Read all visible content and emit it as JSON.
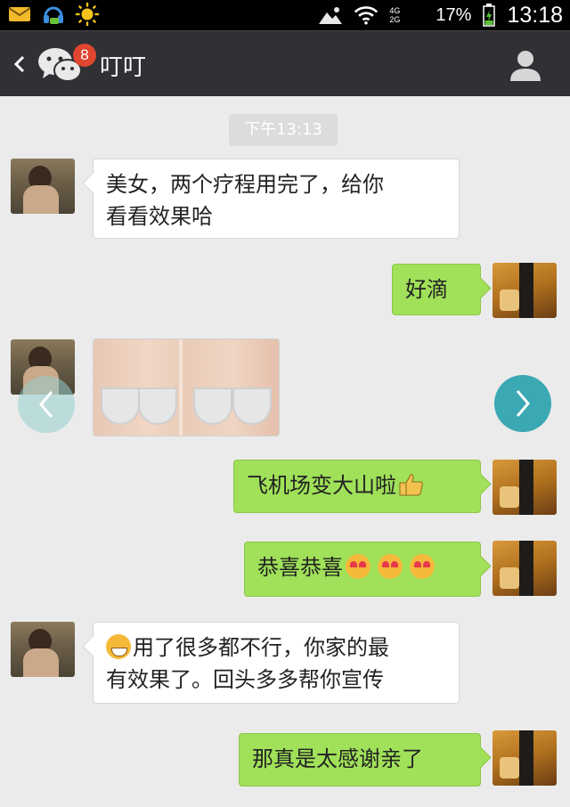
{
  "status_bar": {
    "left_icons": [
      "mail-icon",
      "headset-icon",
      "sun-icon"
    ],
    "right_icons": [
      "mountain-image-icon",
      "wifi-icon",
      "signal-icon",
      "battery-icon"
    ],
    "network_top": "4G",
    "network_bottom": "2G",
    "battery_percent": "17%",
    "time": "13:18"
  },
  "header": {
    "back_icon": "chevron-left-icon",
    "app_icon": "wechat-icon",
    "unread_count": "8",
    "title": "叮叮",
    "profile_icon": "profile-icon"
  },
  "chat": {
    "timestamp": "下午13:13",
    "messages": [
      {
        "side": "left",
        "text": "美女，两个疗程用完了，给你看看效果哈",
        "line1": "美女，两个疗程用完了，给你",
        "line2": "看看效果哈"
      },
      {
        "side": "right",
        "text": "好滴"
      },
      {
        "side": "left",
        "type": "image",
        "image_icon": "photo-thumbnail"
      },
      {
        "side": "right",
        "text": "飞机场变大山啦",
        "emoji": "thumbs-up-icon"
      },
      {
        "side": "right",
        "text": "恭喜恭喜",
        "emoji": "heart-eyes-icon x3"
      },
      {
        "side": "left",
        "text": "用了很多都不行，你家的最有效果了。回头多多帮你宣传",
        "line1": "用了很多都不行，你家的最",
        "line2": "有效果了。回头多多帮你宣传",
        "emoji": "grin-icon"
      },
      {
        "side": "right",
        "text": "那真是太感谢亲了"
      }
    ]
  },
  "carousel": {
    "prev_icon": "chevron-left-icon",
    "next_icon": "chevron-right-icon"
  },
  "colors": {
    "status_bar": "#000000",
    "header": "#2f3134",
    "chat_bg": "#ebebeb",
    "outgoing_bubble": "#a0e159",
    "incoming_bubble": "#ffffff",
    "badge": "#e0452f",
    "next_button": "#3aa9b3"
  }
}
